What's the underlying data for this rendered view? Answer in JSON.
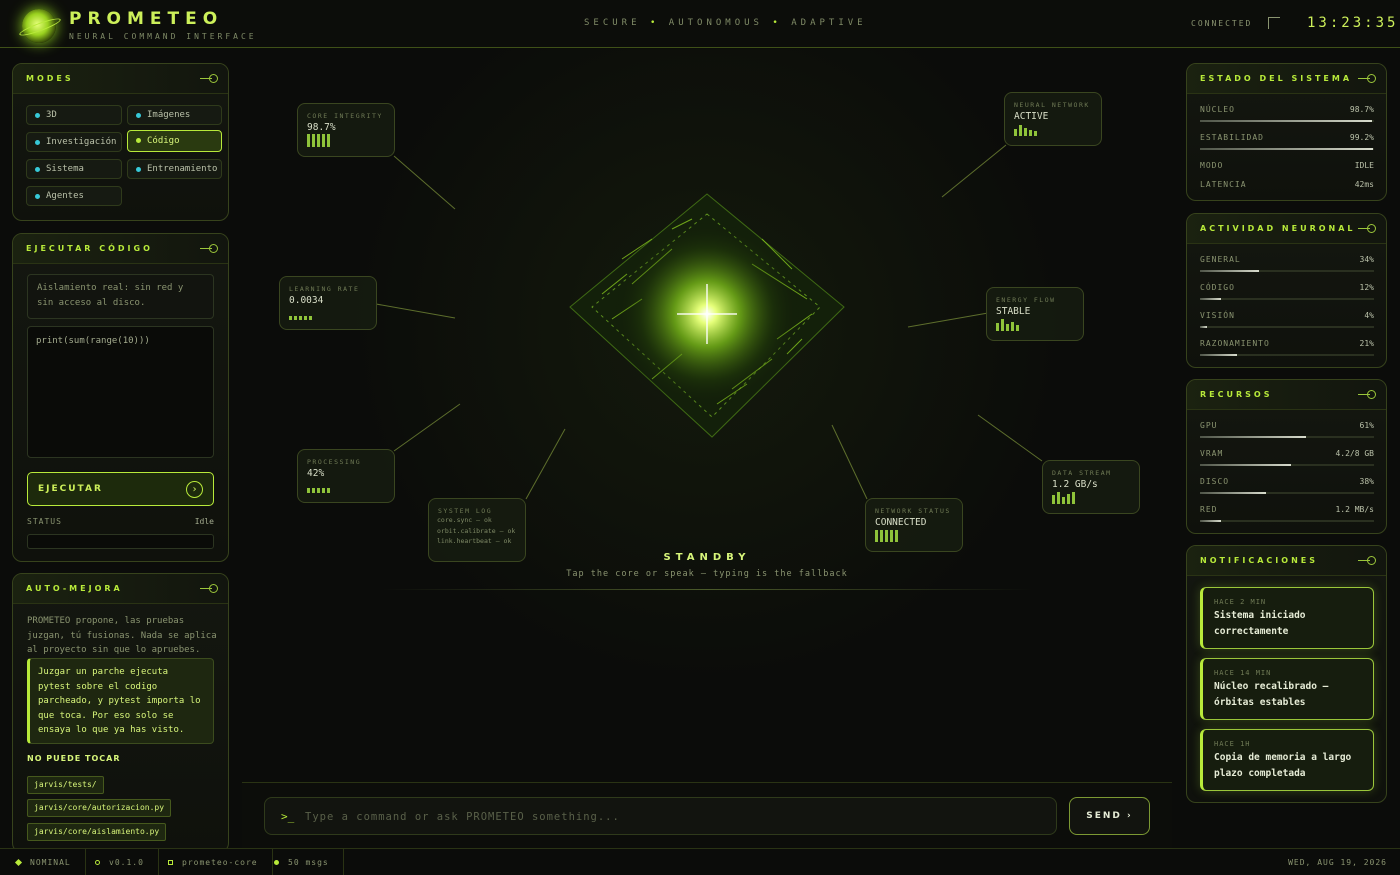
{
  "header": {
    "brand": "PROMETEO",
    "subtitle": "NEURAL COMMAND INTERFACE",
    "tagline": [
      "SECURE",
      "AUTONOMOUS",
      "ADAPTIVE"
    ],
    "connection": "CONNECTED",
    "clock": "13:23:35"
  },
  "modes": {
    "title": "MODES",
    "items": [
      {
        "label": "3D",
        "active": false
      },
      {
        "label": "Imágenes",
        "active": false
      },
      {
        "label": "Investigación",
        "active": false
      },
      {
        "label": "Código",
        "active": true
      },
      {
        "label": "Sistema",
        "active": false
      },
      {
        "label": "Entrenamiento",
        "active": false
      },
      {
        "label": "Agentes",
        "active": false
      }
    ]
  },
  "execute": {
    "title": "EJECUTAR CÓDIGO",
    "hint": "Aislamiento real: sin red y sin acceso al disco.",
    "code": "print(sum(range(10)))",
    "button": "EJECUTAR",
    "status_label": "STATUS",
    "status_value": "Idle"
  },
  "automejora": {
    "title": "AUTO-MEJORA",
    "text": "PROMETEO propone, las pruebas juzgan, tú fusionas. Nada se aplica al proyecto sin que lo apruebes.",
    "quote": "Juzgar un parche ejecuta pytest sobre el codigo parcheado, y pytest importa lo que toca. Por eso solo se ensaya lo que ya has visto.",
    "cannot_touch": "NO PUEDE TOCAR",
    "paths": [
      "jarvis/tests/",
      "jarvis/core/autorizacion.py",
      "jarvis/core/aislamiento.py"
    ]
  },
  "center": {
    "cards": {
      "core_integrity": {
        "label": "CORE INTEGRITY",
        "value": "98.7%"
      },
      "neural_network": {
        "label": "NEURAL NETWORK",
        "value": "ACTIVE"
      },
      "learning_rate": {
        "label": "LEARNING RATE",
        "value": "0.0034"
      },
      "energy_flow": {
        "label": "ENERGY FLOW",
        "value": "STABLE"
      },
      "processing": {
        "label": "PROCESSING",
        "value": "42%"
      },
      "data_stream": {
        "label": "DATA STREAM",
        "value": "1.2 GB/s"
      },
      "system_log": {
        "label": "SYSTEM LOG",
        "lines": [
          "core.sync — ok",
          "orbit.calibrate — ok",
          "link.heartbeat — ok"
        ]
      },
      "network_status": {
        "label": "NETWORK STATUS",
        "value": "CONNECTED"
      }
    },
    "state": "STANDBY",
    "hint": "Tap the core or speak — typing is the fallback"
  },
  "command": {
    "prompt": ">_",
    "placeholder": "Type a command or ask PROMETEO something...",
    "send": "SEND"
  },
  "system_state": {
    "title": "ESTADO DEL SISTEMA",
    "rows": [
      {
        "label": "NÚCLEO",
        "value": "98.7%",
        "level": 0.987
      },
      {
        "label": "ESTABILIDAD",
        "value": "99.2%",
        "level": 0.992
      },
      {
        "label": "MODO",
        "value": "IDLE"
      },
      {
        "label": "LATENCIA",
        "value": "42ms"
      }
    ]
  },
  "neural": {
    "title": "ACTIVIDAD NEURONAL",
    "rows": [
      {
        "label": "GENERAL",
        "value": "34%",
        "level": 0.34
      },
      {
        "label": "CÓDIGO",
        "value": "12%",
        "level": 0.12
      },
      {
        "label": "VISIÓN",
        "value": "4%",
        "level": 0.04
      },
      {
        "label": "RAZONAMIENTO",
        "value": "21%",
        "level": 0.21
      }
    ]
  },
  "resources": {
    "title": "RECURSOS",
    "rows": [
      {
        "label": "GPU",
        "value": "61%",
        "level": 0.61
      },
      {
        "label": "VRAM",
        "value": "4.2/8 GB",
        "level": 0.525
      },
      {
        "label": "DISCO",
        "value": "38%",
        "level": 0.38
      },
      {
        "label": "RED",
        "value": "1.2 MB/s",
        "level": 0.12
      }
    ]
  },
  "notifications": {
    "title": "NOTIFICACIONES",
    "items": [
      {
        "time": "HACE 2 MIN",
        "message": "Sistema iniciado correctamente"
      },
      {
        "time": "HACE 14 MIN",
        "message": "Núcleo recalibrado — órbitas estables"
      },
      {
        "time": "HACE 1H",
        "message": "Copia de memoria a largo plazo completada"
      }
    ]
  },
  "footer": {
    "status": "NOMINAL",
    "version": "v0.1.0",
    "instance": "prometeo-core",
    "msgs": "50 msgs",
    "date": "WED, AUG 19, 2026"
  },
  "colors": {
    "accent": "#b8ea3a",
    "mode_dot": "#37c9d8",
    "background": "#0b0c0a"
  }
}
